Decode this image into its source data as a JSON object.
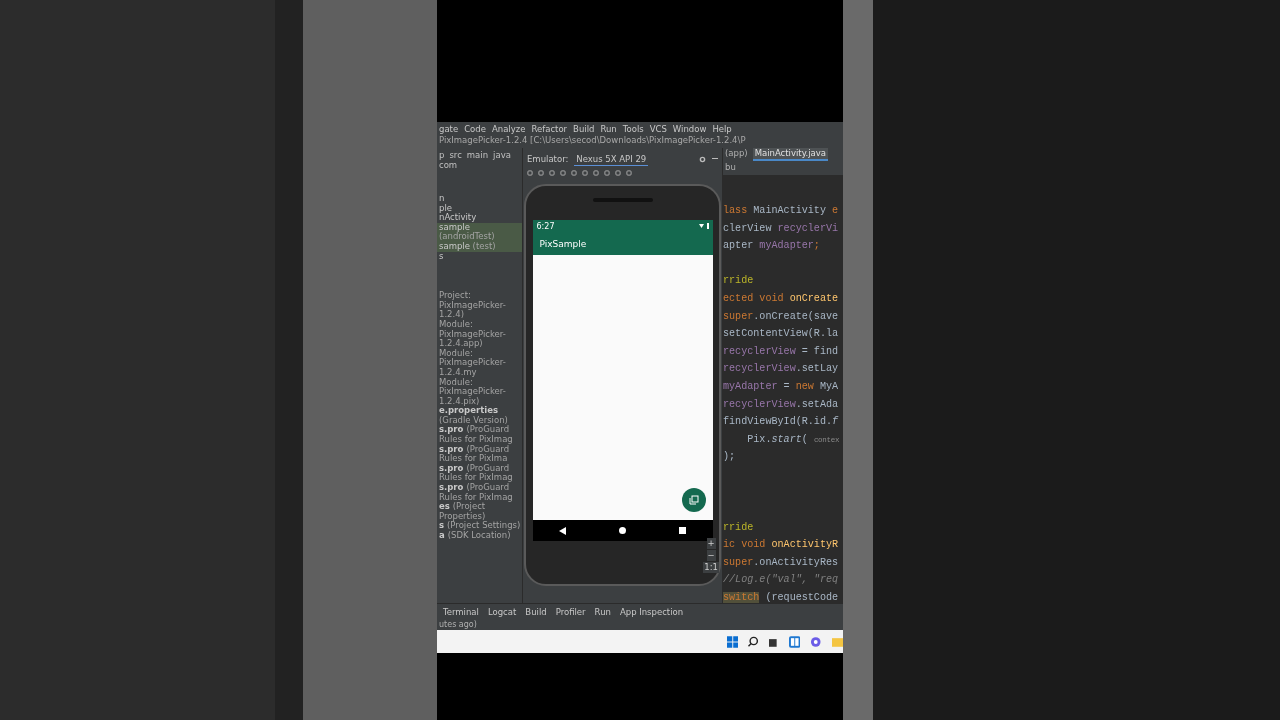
{
  "menu_bar": {
    "items": [
      "gate",
      "Code",
      "Analyze",
      "Refactor",
      "Build",
      "Run",
      "Tools",
      "VCS",
      "Window",
      "Help"
    ],
    "title": "PixImagePicker-1.2.4 [C:\\Users\\secod\\Downloads\\PixImagePicker-1.2.4\\P"
  },
  "breadcrumb": [
    "p",
    "src",
    "main",
    "java",
    "com"
  ],
  "project_tree": [
    {
      "name": "n",
      "selected": false
    },
    {
      "name": "ple",
      "selected": false
    },
    {
      "name": "nActivity",
      "selected": false
    },
    {
      "name": "sample",
      "note": "(androidTest)",
      "selected": true
    },
    {
      "name": "sample",
      "note": "(test)",
      "selected": true
    },
    {
      "name": "s",
      "selected": false
    }
  ],
  "gradle_tree": [
    {
      "note": "Project: PixImagePicker-1.2.4)"
    },
    {
      "note": "Module: PixImagePicker-1.2.4.app)"
    },
    {
      "note": "Module: PixImagePicker-1.2.4.my"
    },
    {
      "note": "Module: PixImagePicker-1.2.4.pix)"
    },
    {
      "name": "e.properties",
      "note": "(Gradle Version)"
    },
    {
      "name": "s.pro",
      "note": "(ProGuard Rules for PixImag"
    },
    {
      "name": "s.pro",
      "note": "(ProGuard Rules for PixIma"
    },
    {
      "name": "s.pro",
      "note": "(ProGuard Rules for PixImag"
    },
    {
      "name": "s.pro",
      "note": "(ProGuard Rules for PixImag"
    },
    {
      "name": "es",
      "note": "(Project Properties)"
    },
    {
      "name": "s",
      "note": "(Project Settings)"
    },
    {
      "name": "a",
      "note": "(SDK Location)"
    }
  ],
  "emulator": {
    "label": "Emulator:",
    "tab": "Nexus 5X API 29",
    "phone": {
      "time": "6:27",
      "app_title": "PixSample"
    },
    "zoom_controls": [
      "+",
      "−",
      "1:1"
    ]
  },
  "editor_tabs": [
    {
      "label": "(app)",
      "selected": false
    },
    {
      "label": "MainActivity.java",
      "selected": true
    },
    {
      "label": "bu",
      "selected": false
    }
  ],
  "code_lines": [
    {
      "kind": "code",
      "segments": [
        {
          "text": "lass",
          "kind": "keyword"
        },
        {
          "text": " MainActivity ",
          "kind": "plain"
        },
        {
          "text": "e",
          "kind": "keyword"
        }
      ]
    },
    {
      "kind": "code",
      "segments": [
        {
          "text": "clerView ",
          "kind": "plain"
        },
        {
          "text": "recyclerVi",
          "kind": "field"
        }
      ]
    },
    {
      "kind": "code",
      "segments": [
        {
          "text": "apter ",
          "kind": "plain"
        },
        {
          "text": "myAdapter",
          "kind": "field"
        },
        {
          "text": ";",
          "kind": "keyword"
        }
      ]
    },
    {
      "kind": "blank"
    },
    {
      "kind": "code",
      "segments": [
        {
          "text": "rride",
          "kind": "annotation"
        }
      ]
    },
    {
      "kind": "code",
      "segments": [
        {
          "text": "ected void ",
          "kind": "keyword"
        },
        {
          "text": "onCreate",
          "kind": "method"
        }
      ]
    },
    {
      "kind": "code",
      "segments": [
        {
          "text": "super",
          "kind": "keyword"
        },
        {
          "text": ".onCreate(save",
          "kind": "plain"
        }
      ]
    },
    {
      "kind": "code",
      "segments": [
        {
          "text": "setContentView(R.la",
          "kind": "plain"
        }
      ]
    },
    {
      "kind": "code",
      "segments": [
        {
          "text": "recyclerView",
          "kind": "field"
        },
        {
          "text": " = find",
          "kind": "plain"
        }
      ]
    },
    {
      "kind": "code",
      "segments": [
        {
          "text": "recyclerView",
          "kind": "field"
        },
        {
          "text": ".setLay",
          "kind": "plain"
        }
      ]
    },
    {
      "kind": "code",
      "segments": [
        {
          "text": "myAdapter",
          "kind": "field"
        },
        {
          "text": " = ",
          "kind": "plain"
        },
        {
          "text": "new",
          "kind": "keyword"
        },
        {
          "text": " MyA",
          "kind": "plain"
        }
      ]
    },
    {
      "kind": "code",
      "segments": [
        {
          "text": "recyclerView",
          "kind": "field"
        },
        {
          "text": ".setAda",
          "kind": "plain"
        }
      ]
    },
    {
      "kind": "code",
      "segments": [
        {
          "text": "findViewById(R.id.",
          "kind": "plain"
        },
        {
          "text": "f",
          "kind": "static"
        }
      ]
    },
    {
      "kind": "code",
      "segments": [
        {
          "text": "    Pix.",
          "kind": "plain"
        },
        {
          "text": "start",
          "kind": "static"
        },
        {
          "text": "( ",
          "kind": "plain"
        },
        {
          "text": "contex",
          "kind": "hint"
        }
      ]
    },
    {
      "kind": "code",
      "segments": [
        {
          "text": ");",
          "kind": "plain"
        }
      ]
    },
    {
      "kind": "blank"
    },
    {
      "kind": "blank"
    },
    {
      "kind": "blank"
    },
    {
      "kind": "code",
      "segments": [
        {
          "text": "rride",
          "kind": "annotation"
        }
      ]
    },
    {
      "kind": "code",
      "segments": [
        {
          "text": "ic void ",
          "kind": "keyword"
        },
        {
          "text": "onActivityR",
          "kind": "method"
        }
      ]
    },
    {
      "kind": "code",
      "segments": [
        {
          "text": "super",
          "kind": "keyword"
        },
        {
          "text": ".onActivityRes",
          "kind": "plain"
        }
      ]
    },
    {
      "kind": "code",
      "segments": [
        {
          "text": "//Log.e(\"val\", \"req",
          "kind": "comment"
        }
      ]
    },
    {
      "kind": "code",
      "segments": [
        {
          "text": "switch",
          "kind": "match"
        },
        {
          "text": " (requestCode",
          "kind": "plain"
        }
      ]
    }
  ],
  "tool_windows": [
    "Terminal",
    "Logcat",
    "Build",
    "Profiler",
    "Run",
    "App Inspection"
  ],
  "status": "utes ago)"
}
